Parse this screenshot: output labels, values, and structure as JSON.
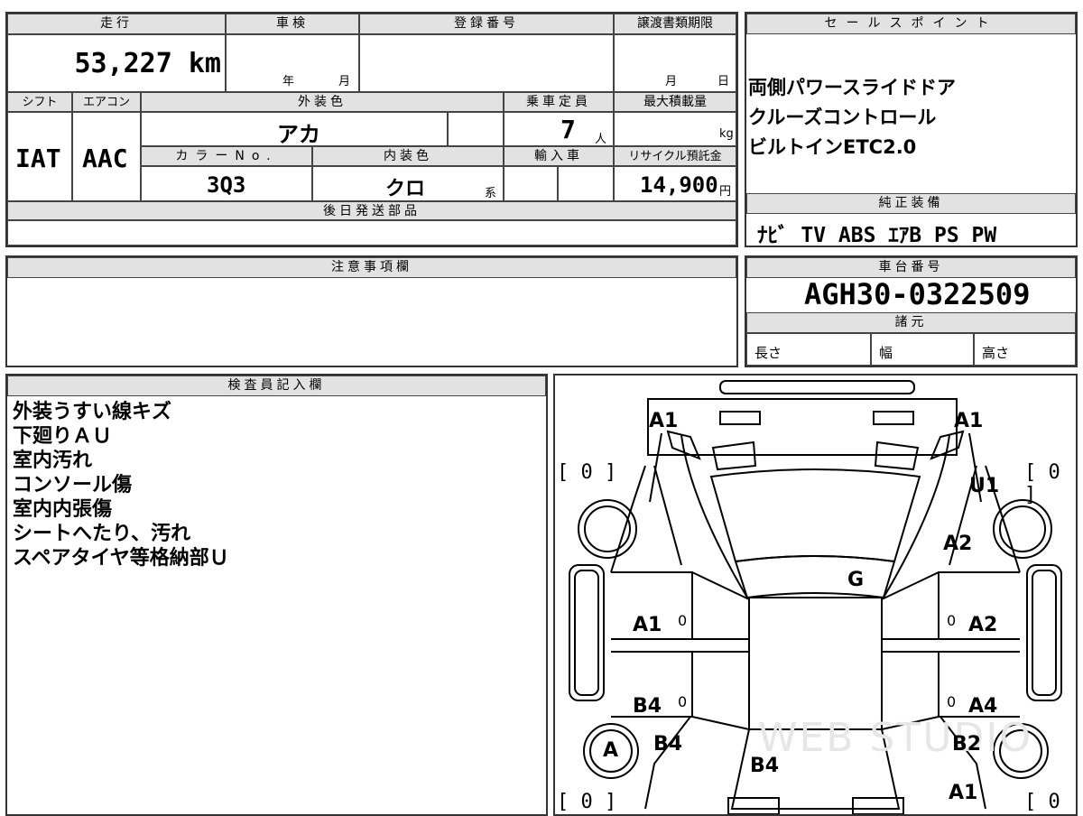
{
  "vehicle": {
    "mileage_label": "走行",
    "mileage_value": "53,227 km",
    "inspection_label": "車検",
    "inspection_year": "年",
    "inspection_month": "月",
    "registration_label": "登録番号",
    "transfer_label": "譲渡書類期限",
    "transfer_month": "月",
    "transfer_day": "日",
    "shift_label": "シフト",
    "shift_value": "IAT",
    "ac_label": "エアコン",
    "ac_value": "AAC",
    "exterior_label": "外装色",
    "exterior_value": "アカ",
    "color_no_label": "カラーNo.",
    "color_no_value": "3Q3",
    "interior_label": "内装色",
    "interior_value": "クロ",
    "interior_suffix": "系",
    "capacity_label": "乗車定員",
    "capacity_value": "7",
    "capacity_unit": "人",
    "import_label": "輸入車",
    "max_load_label": "最大積載量",
    "max_load_unit": "kg",
    "recycle_label": "リサイクル預託金",
    "recycle_value": "14,900",
    "recycle_unit": "円",
    "later_parts_label": "後日発送部品"
  },
  "sales_points": {
    "label": "セールスポイント",
    "items": [
      "両側パワースライドドア",
      "クルーズコントロール",
      "ビルトインETC2.0"
    ]
  },
  "equipment": {
    "label": "純正装備",
    "value": "ﾅﾋﾞ TV ABS ｴｱB PS PW"
  },
  "notes": {
    "label": "注意事項欄"
  },
  "chassis": {
    "label": "車台番号",
    "value": "AGH30-0322509",
    "specs_label": "諸元",
    "length_label": "長さ",
    "width_label": "幅",
    "height_label": "高さ"
  },
  "inspector": {
    "label": "検査員記入欄",
    "lines": [
      "外装うすい線キズ",
      "下廻りＡＵ",
      "室内汚れ",
      "コンソール傷",
      "室内内張傷",
      "シートへたり、汚れ",
      "スペアタイヤ等格納部Ｕ"
    ]
  },
  "diagram": {
    "marks": {
      "front_left_a1": "A1",
      "front_right_a1": "A1",
      "right_front_u1": "U1",
      "right_front_a2": "A2",
      "roof_g": "G",
      "left_door_a1": "A1",
      "right_door_a2": "A2",
      "left_rear_door_b4": "B4",
      "right_rear_door_a4": "A4",
      "left_rear_b4": "B4",
      "right_rear_b2": "B2",
      "rear_b4": "B4",
      "right_rear_a1": "A1",
      "tire_a": "A",
      "small_0_a": "0",
      "small_0_b": "0",
      "small_0_c": "0",
      "small_0_d": "0"
    },
    "brackets": {
      "tl": "[ 0 ]",
      "tr": "[ 0 ]",
      "bl": "[ 0 ]",
      "br": "[ 0 ]"
    },
    "watermark": "WEB STUDIO"
  }
}
